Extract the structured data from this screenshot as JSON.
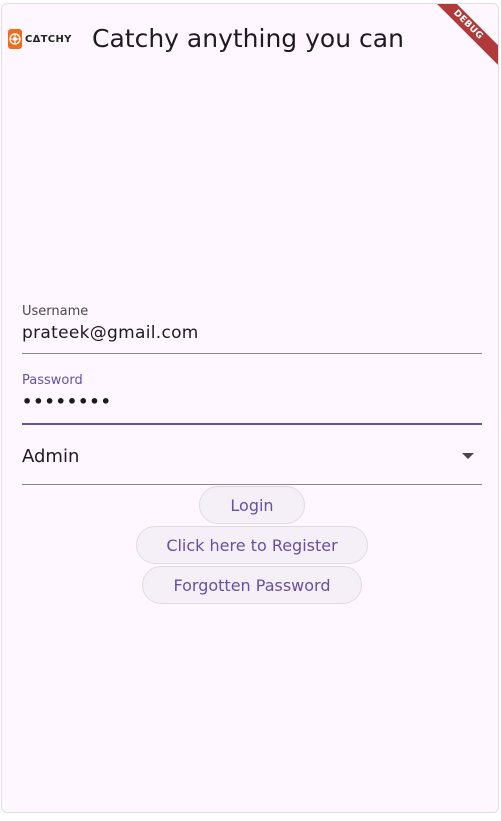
{
  "appbar": {
    "logo_text": "CΔTCHY",
    "title": "Catchy anything you can",
    "debug_label": "DEBUG"
  },
  "form": {
    "username": {
      "label": "Username",
      "value": "prateek@gmail.com"
    },
    "password": {
      "label": "Password",
      "value": "••••••••"
    },
    "role": {
      "selected": "Admin"
    }
  },
  "buttons": {
    "login": "Login",
    "register": "Click here to Register",
    "forgot": "Forgotten Password"
  },
  "colors": {
    "primary": "#6750a4",
    "background": "#fef7ff",
    "button_bg": "#f5eff7",
    "logo_orange": "#f26b1d",
    "debug_red": "#b03a3a"
  }
}
